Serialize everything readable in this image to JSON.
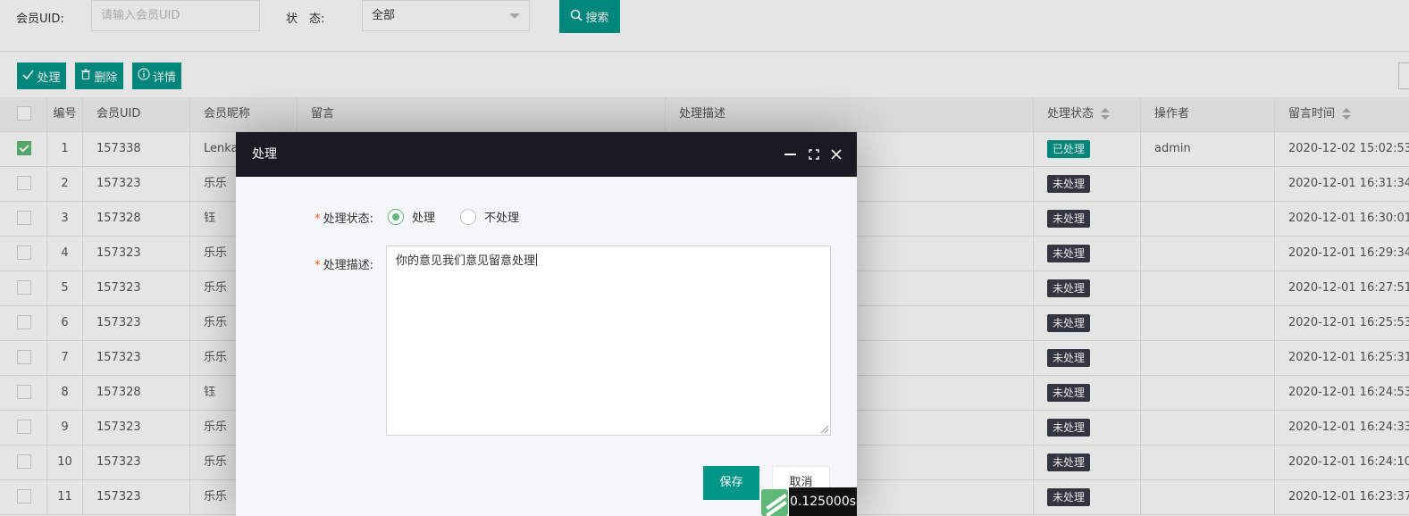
{
  "search": {
    "uid_label": "会员UID:",
    "uid_placeholder": "请输入会员UID",
    "status_label": "状　态:",
    "status_value": "全部",
    "search_button": "搜索"
  },
  "toolbar": {
    "process_button": "处理",
    "delete_button": "删除",
    "detail_button": "详情"
  },
  "table": {
    "headers": {
      "no": "编号",
      "uid": "会员UID",
      "nickname": "会员昵称",
      "message": "留言",
      "description": "处理描述",
      "status": "处理状态",
      "operator": "操作者",
      "time": "留言时间"
    },
    "rows": [
      {
        "no": "1",
        "uid": "157338",
        "nickname": "Lenka",
        "status": "已处理",
        "operator": "admin",
        "time": "2020-12-02 15:02:53",
        "checked": true
      },
      {
        "no": "2",
        "uid": "157323",
        "nickname": "乐乐",
        "status": "未处理",
        "operator": "",
        "time": "2020-12-01 16:31:34",
        "checked": false
      },
      {
        "no": "3",
        "uid": "157328",
        "nickname": "钰",
        "status": "未处理",
        "operator": "",
        "time": "2020-12-01 16:30:01",
        "checked": false
      },
      {
        "no": "4",
        "uid": "157323",
        "nickname": "乐乐",
        "status": "未处理",
        "operator": "",
        "time": "2020-12-01 16:29:34",
        "checked": false
      },
      {
        "no": "5",
        "uid": "157323",
        "nickname": "乐乐",
        "status": "未处理",
        "operator": "",
        "time": "2020-12-01 16:27:51",
        "checked": false
      },
      {
        "no": "6",
        "uid": "157323",
        "nickname": "乐乐",
        "status": "未处理",
        "operator": "",
        "time": "2020-12-01 16:25:53",
        "checked": false
      },
      {
        "no": "7",
        "uid": "157323",
        "nickname": "乐乐",
        "status": "未处理",
        "operator": "",
        "time": "2020-12-01 16:25:31",
        "checked": false
      },
      {
        "no": "8",
        "uid": "157328",
        "nickname": "钰",
        "status": "未处理",
        "operator": "",
        "time": "2020-12-01 16:24:53",
        "checked": false
      },
      {
        "no": "9",
        "uid": "157323",
        "nickname": "乐乐",
        "status": "未处理",
        "operator": "",
        "time": "2020-12-01 16:24:33",
        "checked": false
      },
      {
        "no": "10",
        "uid": "157323",
        "nickname": "乐乐",
        "status": "未处理",
        "operator": "",
        "time": "2020-12-01 16:24:10",
        "checked": false
      },
      {
        "no": "11",
        "uid": "157323",
        "nickname": "乐乐",
        "status": "未处理",
        "operator": "",
        "time": "2020-12-01 16:23:37",
        "checked": false
      }
    ]
  },
  "dialog": {
    "title": "处理",
    "status_label": "处理状态:",
    "required_mark": "*",
    "radio_process": "处理",
    "radio_no_process": "不处理",
    "selected": "处理",
    "desc_label": "处理描述:",
    "desc_value": "你的意见我们意见留意处理",
    "save_button": "保存",
    "cancel_button": "取消"
  },
  "timer": {
    "text": "0.125000s"
  },
  "colors": {
    "primary": "#009688",
    "dialog_header": "#191a23",
    "pending_badge": "#393D49",
    "radio_checked": "#5FB878",
    "required": "#ff5722"
  },
  "icons": {
    "search": "magnifier-icon",
    "process": "check-icon",
    "delete": "trash-icon",
    "detail": "info-icon"
  }
}
